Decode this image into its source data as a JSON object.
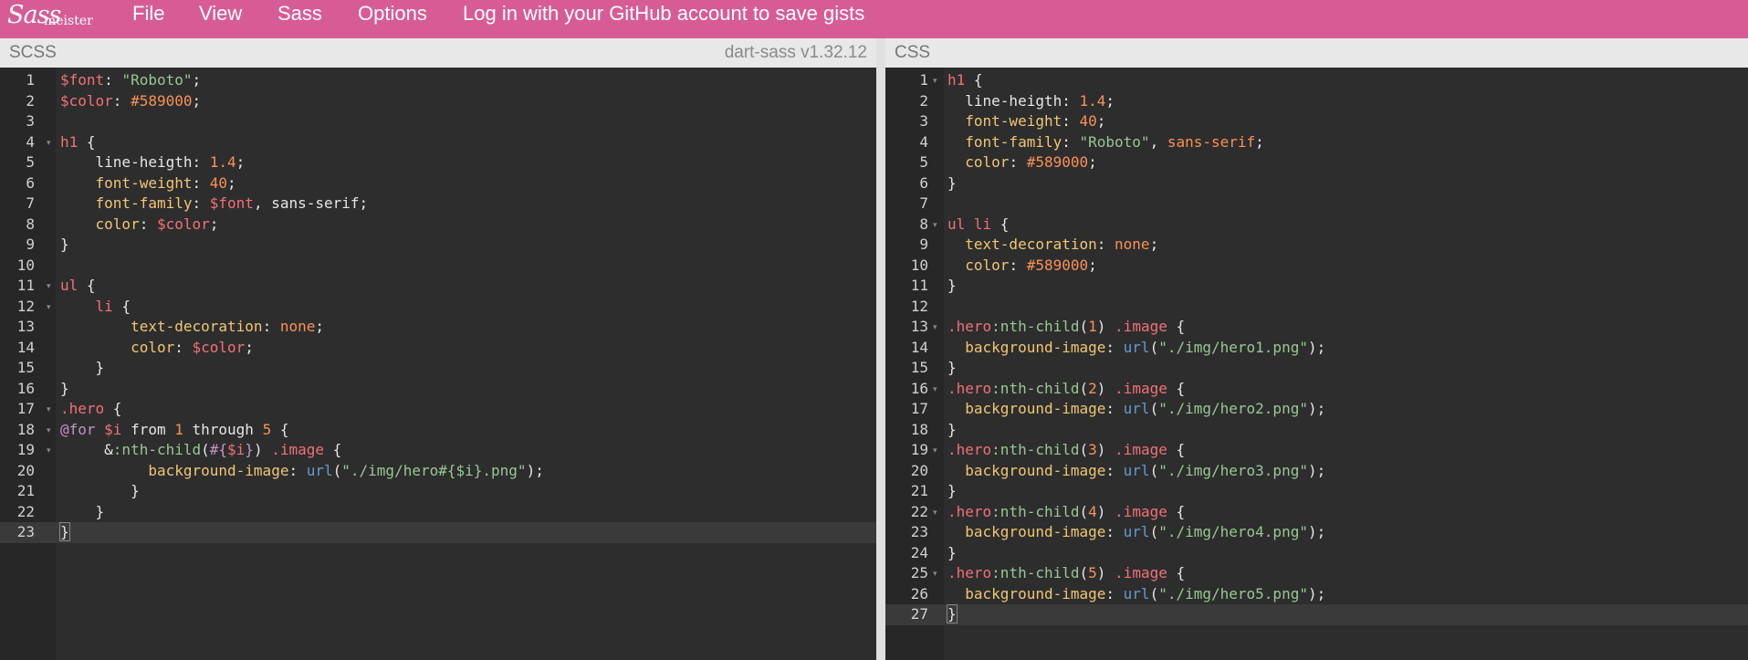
{
  "logo": {
    "script": "Sass",
    "word": "meister"
  },
  "menu": {
    "file": "File",
    "view": "View",
    "sass": "Sass",
    "options": "Options",
    "login": "Log in with your GitHub account to save gists"
  },
  "left_pane": {
    "title": "SCSS",
    "version": "dart-sass v1.32.12",
    "lines": [
      [
        [
          "t-var",
          "$font"
        ],
        [
          "t-punc",
          ": "
        ],
        [
          "t-str",
          "\"Roboto\""
        ],
        [
          "t-punc",
          ";"
        ]
      ],
      [
        [
          "t-var",
          "$color"
        ],
        [
          "t-punc",
          ": "
        ],
        [
          "t-num",
          "#589000"
        ],
        [
          "t-punc",
          ";"
        ]
      ],
      [],
      [
        [
          "t-sel",
          "h1"
        ],
        [
          "t-punc",
          " {"
        ]
      ],
      [
        [
          "t-punc",
          "    "
        ],
        [
          "t-punc",
          "line-heigth"
        ],
        [
          "t-punc",
          ": "
        ],
        [
          "t-num",
          "1.4"
        ],
        [
          "t-punc",
          ";"
        ]
      ],
      [
        [
          "t-punc",
          "    "
        ],
        [
          "t-prop",
          "font-weight"
        ],
        [
          "t-punc",
          ": "
        ],
        [
          "t-num",
          "40"
        ],
        [
          "t-punc",
          ";"
        ]
      ],
      [
        [
          "t-punc",
          "    "
        ],
        [
          "t-prop",
          "font-family"
        ],
        [
          "t-punc",
          ": "
        ],
        [
          "t-var",
          "$font"
        ],
        [
          "t-punc",
          ", sans-serif;"
        ]
      ],
      [
        [
          "t-punc",
          "    "
        ],
        [
          "t-prop",
          "color"
        ],
        [
          "t-punc",
          ": "
        ],
        [
          "t-var",
          "$color"
        ],
        [
          "t-punc",
          ";"
        ]
      ],
      [
        [
          "t-punc",
          "}"
        ]
      ],
      [],
      [
        [
          "t-sel",
          "ul"
        ],
        [
          "t-punc",
          " {"
        ]
      ],
      [
        [
          "t-punc",
          "    "
        ],
        [
          "t-sel",
          "li"
        ],
        [
          "t-punc",
          " {"
        ]
      ],
      [
        [
          "t-punc",
          "        "
        ],
        [
          "t-prop",
          "text-decoration"
        ],
        [
          "t-punc",
          ": "
        ],
        [
          "t-num",
          "none"
        ],
        [
          "t-punc",
          ";"
        ]
      ],
      [
        [
          "t-punc",
          "        "
        ],
        [
          "t-prop",
          "color"
        ],
        [
          "t-punc",
          ": "
        ],
        [
          "t-var",
          "$color"
        ],
        [
          "t-punc",
          ";"
        ]
      ],
      [
        [
          "t-punc",
          "    }"
        ]
      ],
      [
        [
          "t-punc",
          "}"
        ]
      ],
      [
        [
          "t-sel",
          ".hero"
        ],
        [
          "t-punc",
          " {"
        ]
      ],
      [
        [
          "t-kw",
          "@for"
        ],
        [
          "t-punc",
          " "
        ],
        [
          "t-var",
          "$i"
        ],
        [
          "t-punc",
          " from "
        ],
        [
          "t-num",
          "1"
        ],
        [
          "t-punc",
          " through "
        ],
        [
          "t-num",
          "5"
        ],
        [
          "t-punc",
          " {"
        ]
      ],
      [
        [
          "t-punc",
          "     &"
        ],
        [
          "t-pseudo",
          ":nth-child"
        ],
        [
          "t-punc",
          "("
        ],
        [
          "t-interp",
          "#{"
        ],
        [
          "t-var",
          "$i"
        ],
        [
          "t-interp",
          "}"
        ],
        [
          "t-punc",
          ") "
        ],
        [
          "t-sel",
          ".image"
        ],
        [
          "t-punc",
          " {"
        ]
      ],
      [
        [
          "t-punc",
          "          "
        ],
        [
          "t-prop",
          "background-image"
        ],
        [
          "t-punc",
          ": "
        ],
        [
          "t-url",
          "url"
        ],
        [
          "t-punc",
          "("
        ],
        [
          "t-str",
          "\"./img/hero#{$i}.png\""
        ],
        [
          "t-punc",
          ");"
        ]
      ],
      [
        [
          "t-punc",
          "        }"
        ]
      ],
      [
        [
          "t-punc",
          "    }"
        ]
      ],
      [
        [
          "t-punc",
          "}"
        ]
      ]
    ],
    "fold_lines": [
      4,
      11,
      12,
      17,
      18,
      19
    ],
    "active_line": 23
  },
  "right_pane": {
    "title": "CSS",
    "lines": [
      [
        [
          "t-sel",
          "h1"
        ],
        [
          "t-punc",
          " {"
        ]
      ],
      [
        [
          "t-punc",
          "  "
        ],
        [
          "t-punc",
          "line-heigth"
        ],
        [
          "t-punc",
          ": "
        ],
        [
          "t-num",
          "1.4"
        ],
        [
          "t-punc",
          ";"
        ]
      ],
      [
        [
          "t-punc",
          "  "
        ],
        [
          "t-prop",
          "font-weight"
        ],
        [
          "t-punc",
          ": "
        ],
        [
          "t-num",
          "40"
        ],
        [
          "t-punc",
          ";"
        ]
      ],
      [
        [
          "t-punc",
          "  "
        ],
        [
          "t-prop",
          "font-family"
        ],
        [
          "t-punc",
          ": "
        ],
        [
          "t-str",
          "\"Roboto\""
        ],
        [
          "t-punc",
          ", "
        ],
        [
          "t-num",
          "sans-serif"
        ],
        [
          "t-punc",
          ";"
        ]
      ],
      [
        [
          "t-punc",
          "  "
        ],
        [
          "t-prop",
          "color"
        ],
        [
          "t-punc",
          ": "
        ],
        [
          "t-num",
          "#589000"
        ],
        [
          "t-punc",
          ";"
        ]
      ],
      [
        [
          "t-punc",
          "}"
        ]
      ],
      [],
      [
        [
          "t-sel",
          "ul li"
        ],
        [
          "t-punc",
          " {"
        ]
      ],
      [
        [
          "t-punc",
          "  "
        ],
        [
          "t-prop",
          "text-decoration"
        ],
        [
          "t-punc",
          ": "
        ],
        [
          "t-num",
          "none"
        ],
        [
          "t-punc",
          ";"
        ]
      ],
      [
        [
          "t-punc",
          "  "
        ],
        [
          "t-prop",
          "color"
        ],
        [
          "t-punc",
          ": "
        ],
        [
          "t-num",
          "#589000"
        ],
        [
          "t-punc",
          ";"
        ]
      ],
      [
        [
          "t-punc",
          "}"
        ]
      ],
      [],
      [
        [
          "t-sel",
          ".hero"
        ],
        [
          "t-pseudo",
          ":nth-child"
        ],
        [
          "t-punc",
          "("
        ],
        [
          "t-num",
          "1"
        ],
        [
          "t-punc",
          ") "
        ],
        [
          "t-sel",
          ".image"
        ],
        [
          "t-punc",
          " {"
        ]
      ],
      [
        [
          "t-punc",
          "  "
        ],
        [
          "t-prop",
          "background-image"
        ],
        [
          "t-punc",
          ": "
        ],
        [
          "t-url",
          "url"
        ],
        [
          "t-punc",
          "("
        ],
        [
          "t-str",
          "\"./img/hero1.png\""
        ],
        [
          "t-punc",
          ");"
        ]
      ],
      [
        [
          "t-punc",
          "}"
        ]
      ],
      [
        [
          "t-sel",
          ".hero"
        ],
        [
          "t-pseudo",
          ":nth-child"
        ],
        [
          "t-punc",
          "("
        ],
        [
          "t-num",
          "2"
        ],
        [
          "t-punc",
          ") "
        ],
        [
          "t-sel",
          ".image"
        ],
        [
          "t-punc",
          " {"
        ]
      ],
      [
        [
          "t-punc",
          "  "
        ],
        [
          "t-prop",
          "background-image"
        ],
        [
          "t-punc",
          ": "
        ],
        [
          "t-url",
          "url"
        ],
        [
          "t-punc",
          "("
        ],
        [
          "t-str",
          "\"./img/hero2.png\""
        ],
        [
          "t-punc",
          ");"
        ]
      ],
      [
        [
          "t-punc",
          "}"
        ]
      ],
      [
        [
          "t-sel",
          ".hero"
        ],
        [
          "t-pseudo",
          ":nth-child"
        ],
        [
          "t-punc",
          "("
        ],
        [
          "t-num",
          "3"
        ],
        [
          "t-punc",
          ") "
        ],
        [
          "t-sel",
          ".image"
        ],
        [
          "t-punc",
          " {"
        ]
      ],
      [
        [
          "t-punc",
          "  "
        ],
        [
          "t-prop",
          "background-image"
        ],
        [
          "t-punc",
          ": "
        ],
        [
          "t-url",
          "url"
        ],
        [
          "t-punc",
          "("
        ],
        [
          "t-str",
          "\"./img/hero3.png\""
        ],
        [
          "t-punc",
          ");"
        ]
      ],
      [
        [
          "t-punc",
          "}"
        ]
      ],
      [
        [
          "t-sel",
          ".hero"
        ],
        [
          "t-pseudo",
          ":nth-child"
        ],
        [
          "t-punc",
          "("
        ],
        [
          "t-num",
          "4"
        ],
        [
          "t-punc",
          ") "
        ],
        [
          "t-sel",
          ".image"
        ],
        [
          "t-punc",
          " {"
        ]
      ],
      [
        [
          "t-punc",
          "  "
        ],
        [
          "t-prop",
          "background-image"
        ],
        [
          "t-punc",
          ": "
        ],
        [
          "t-url",
          "url"
        ],
        [
          "t-punc",
          "("
        ],
        [
          "t-str",
          "\"./img/hero4.png\""
        ],
        [
          "t-punc",
          ");"
        ]
      ],
      [
        [
          "t-punc",
          "}"
        ]
      ],
      [
        [
          "t-sel",
          ".hero"
        ],
        [
          "t-pseudo",
          ":nth-child"
        ],
        [
          "t-punc",
          "("
        ],
        [
          "t-num",
          "5"
        ],
        [
          "t-punc",
          ") "
        ],
        [
          "t-sel",
          ".image"
        ],
        [
          "t-punc",
          " {"
        ]
      ],
      [
        [
          "t-punc",
          "  "
        ],
        [
          "t-prop",
          "background-image"
        ],
        [
          "t-punc",
          ": "
        ],
        [
          "t-url",
          "url"
        ],
        [
          "t-punc",
          "("
        ],
        [
          "t-str",
          "\"./img/hero5.png\""
        ],
        [
          "t-punc",
          ");"
        ]
      ],
      [
        [
          "t-punc",
          "}"
        ]
      ]
    ],
    "fold_lines": [
      1,
      8,
      13,
      16,
      19,
      22,
      25
    ],
    "active_line": 27
  },
  "colors": {
    "topbar": "#d75c96",
    "editor_bg": "#2d2d2d",
    "gutter_bg": "#272727",
    "active_line": "#3a3a3a"
  },
  "icons": {
    "fold": "triangle-down-icon"
  }
}
